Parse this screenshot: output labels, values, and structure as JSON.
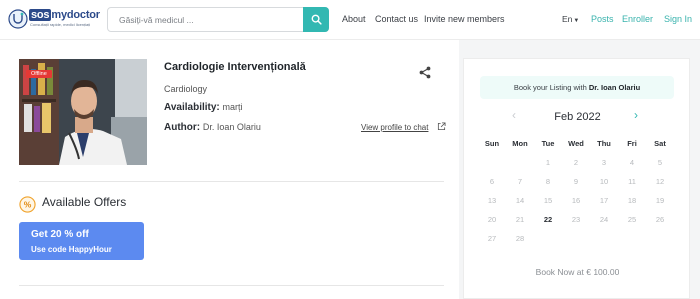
{
  "header": {
    "logo_sos": "sos",
    "logo_text": "mydoctor",
    "logo_tagline": "Consultații rapide, medici licențiați",
    "search_placeholder": "Găsiți-vă medicul ...",
    "nav": [
      "About",
      "Contact us",
      "Invite new members"
    ],
    "lang": "En",
    "links": [
      "Posts",
      "Enroller",
      "Sign In"
    ],
    "accent": "#32b8b2"
  },
  "listing": {
    "status": "Offline",
    "title": "Cardiologie Intervențională",
    "specialty": "Cardiology",
    "availability_label": "Availability:",
    "availability_value": "marți",
    "author_label": "Author:",
    "author_value": "Dr. Ioan Olariu",
    "view_profile": "View profile to chat"
  },
  "offers": {
    "title": "Available Offers",
    "coupon_line1": "Get 20 % off",
    "coupon_line2": "Use code HappyHour",
    "coupon_color": "#5c8af0"
  },
  "booking": {
    "banner_prefix": "Book your Listing with",
    "banner_doctor": "Dr. Ioan Olariu",
    "month": "Feb 2022",
    "weekdays": [
      "Sun",
      "Mon",
      "Tue",
      "Wed",
      "Thu",
      "Fri",
      "Sat"
    ],
    "weeks": [
      [
        "",
        "",
        "1",
        "2",
        "3",
        "4",
        "5"
      ],
      [
        "6",
        "7",
        "8",
        "9",
        "10",
        "11",
        "12"
      ],
      [
        "13",
        "14",
        "15",
        "16",
        "17",
        "18",
        "19"
      ],
      [
        "20",
        "21",
        "22",
        "23",
        "24",
        "25",
        "26"
      ],
      [
        "27",
        "28",
        "",
        "",
        "",
        "",
        ""
      ]
    ],
    "today": "22",
    "book_now": "Book Now at € 100.00"
  }
}
